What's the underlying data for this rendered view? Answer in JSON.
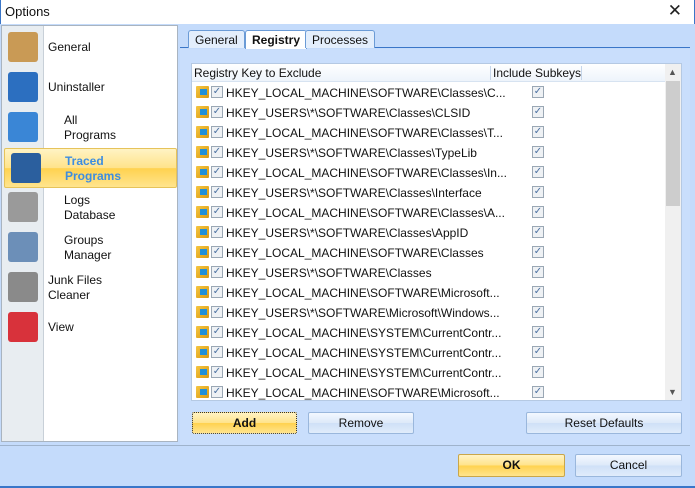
{
  "window": {
    "title": "Options",
    "close_icon": "close-icon"
  },
  "sidebar": {
    "items": [
      {
        "label": "General",
        "icon": "clipboard-check-icon",
        "color": "#c99a55",
        "selected": false
      },
      {
        "label": "Uninstaller",
        "icon": "revo-uninstaller-icon",
        "color": "#2c6fc0",
        "selected": false
      },
      {
        "label": "All\nPrograms",
        "icon": "programs-box-icon",
        "color": "#3a86d6",
        "selected": false
      },
      {
        "label": "Traced\nPrograms",
        "icon": "traced-user-icon",
        "color": "#2b5f9e",
        "selected": true
      },
      {
        "label": "Logs\nDatabase",
        "icon": "database-icon",
        "color": "#9a9a9a",
        "selected": false
      },
      {
        "label": "Groups\nManager",
        "icon": "groups-window-icon",
        "color": "#6c8fb8",
        "selected": false
      },
      {
        "label": "Junk Files\nCleaner",
        "icon": "vacuum-cleaner-icon",
        "color": "#8a8a8a",
        "selected": false
      },
      {
        "label": "View",
        "icon": "equalizer-gear-icon",
        "color": "#d8323b",
        "selected": false
      }
    ]
  },
  "tabs": [
    {
      "label": "General",
      "active": false
    },
    {
      "label": "Registry",
      "active": true
    },
    {
      "label": "Processes",
      "active": false
    }
  ],
  "list": {
    "columns": [
      "Registry Key to Exclude",
      "Include Subkeys"
    ],
    "rows": [
      {
        "key": "HKEY_LOCAL_MACHINE\\SOFTWARE\\Classes\\C...",
        "checked": true,
        "subkeys": true
      },
      {
        "key": "HKEY_USERS\\*\\SOFTWARE\\Classes\\CLSID",
        "checked": true,
        "subkeys": true
      },
      {
        "key": "HKEY_LOCAL_MACHINE\\SOFTWARE\\Classes\\T...",
        "checked": true,
        "subkeys": true
      },
      {
        "key": "HKEY_USERS\\*\\SOFTWARE\\Classes\\TypeLib",
        "checked": true,
        "subkeys": true
      },
      {
        "key": "HKEY_LOCAL_MACHINE\\SOFTWARE\\Classes\\In...",
        "checked": true,
        "subkeys": true
      },
      {
        "key": "HKEY_USERS\\*\\SOFTWARE\\Classes\\Interface",
        "checked": true,
        "subkeys": true
      },
      {
        "key": "HKEY_LOCAL_MACHINE\\SOFTWARE\\Classes\\A...",
        "checked": true,
        "subkeys": true
      },
      {
        "key": "HKEY_USERS\\*\\SOFTWARE\\Classes\\AppID",
        "checked": true,
        "subkeys": true
      },
      {
        "key": "HKEY_LOCAL_MACHINE\\SOFTWARE\\Classes",
        "checked": true,
        "subkeys": true
      },
      {
        "key": "HKEY_USERS\\*\\SOFTWARE\\Classes",
        "checked": true,
        "subkeys": true
      },
      {
        "key": "HKEY_LOCAL_MACHINE\\SOFTWARE\\Microsoft...",
        "checked": true,
        "subkeys": true
      },
      {
        "key": "HKEY_USERS\\*\\SOFTWARE\\Microsoft\\Windows...",
        "checked": true,
        "subkeys": true
      },
      {
        "key": "HKEY_LOCAL_MACHINE\\SYSTEM\\CurrentContr...",
        "checked": true,
        "subkeys": true
      },
      {
        "key": "HKEY_LOCAL_MACHINE\\SYSTEM\\CurrentContr...",
        "checked": true,
        "subkeys": true
      },
      {
        "key": "HKEY_LOCAL_MACHINE\\SYSTEM\\CurrentContr...",
        "checked": true,
        "subkeys": true
      },
      {
        "key": "HKEY_LOCAL_MACHINE\\SOFTWARE\\Microsoft...",
        "checked": true,
        "subkeys": true
      }
    ]
  },
  "buttons": {
    "add": "Add",
    "remove": "Remove",
    "reset": "Reset Defaults",
    "ok": "OK",
    "cancel": "Cancel"
  }
}
